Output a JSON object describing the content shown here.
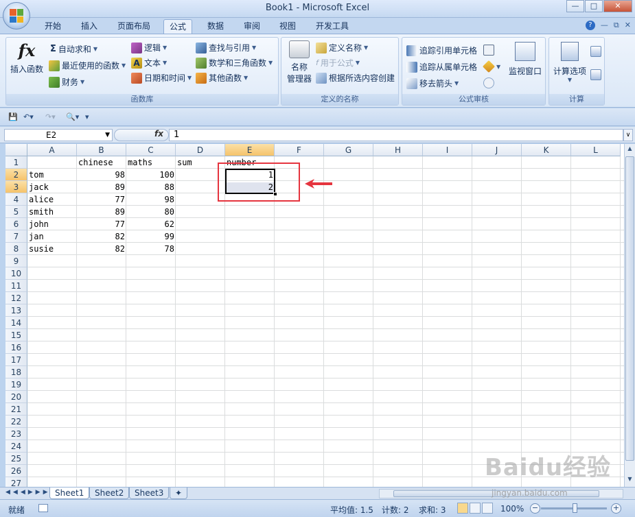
{
  "window": {
    "title": "Book1 - Microsoft Excel",
    "buttons": [
      "minimize",
      "maximize",
      "close"
    ]
  },
  "tabs": [
    {
      "label": "开始",
      "active": false
    },
    {
      "label": "插入",
      "active": false
    },
    {
      "label": "页面布局",
      "active": false
    },
    {
      "label": "公式",
      "active": true
    },
    {
      "label": "数据",
      "active": false
    },
    {
      "label": "审阅",
      "active": false
    },
    {
      "label": "视图",
      "active": false
    },
    {
      "label": "开发工具",
      "active": false
    }
  ],
  "ribbon": {
    "function_library": {
      "label": "函数库",
      "insert_function": "插入函数",
      "fx_symbol": "fx",
      "autosum": "自动求和",
      "recent": "最近使用的函数",
      "financial": "财务",
      "logical": "逻辑",
      "text": "文本",
      "datetime": "日期和时间",
      "lookup": "查找与引用",
      "math": "数学和三角函数",
      "more": "其他函数"
    },
    "defined_names": {
      "label": "定义的名称",
      "name_manager_line1": "名称",
      "name_manager_line2": "管理器",
      "define_name": "定义名称",
      "use_in_formula": "用于公式",
      "create_from_selection": "根据所选内容创建"
    },
    "formula_auditing": {
      "label": "公式审核",
      "trace_precedents": "追踪引用单元格",
      "trace_dependents": "追踪从属单元格",
      "remove_arrows": "移去箭头",
      "watch_window": "监视窗口"
    },
    "calculation": {
      "label": "计算",
      "calc_options": "计算选项"
    }
  },
  "formula_bar": {
    "name_box": "E2",
    "fx_label": "fx",
    "formula": "1"
  },
  "columns": [
    "A",
    "B",
    "C",
    "D",
    "E",
    "F",
    "G",
    "H",
    "I",
    "J",
    "K",
    "L"
  ],
  "rows": [
    "1",
    "2",
    "3",
    "4",
    "5",
    "6",
    "7",
    "8",
    "9",
    "10",
    "11",
    "12",
    "13",
    "14",
    "15",
    "16",
    "17",
    "18",
    "19",
    "20",
    "21",
    "22",
    "23",
    "24",
    "25",
    "26",
    "27"
  ],
  "selected_column": "E",
  "selected_rows": [
    "2",
    "3"
  ],
  "cells": {
    "headers": [
      "",
      "chinese",
      "maths",
      "sum",
      "number"
    ],
    "data": [
      {
        "name": "tom",
        "chinese": "98",
        "maths": "100",
        "number": "1"
      },
      {
        "name": "jack",
        "chinese": "89",
        "maths": "88",
        "number": "2"
      },
      {
        "name": "alice",
        "chinese": "77",
        "maths": "98"
      },
      {
        "name": "smith",
        "chinese": "89",
        "maths": "80"
      },
      {
        "name": "john",
        "chinese": "77",
        "maths": "62"
      },
      {
        "name": "jan",
        "chinese": "82",
        "maths": "99"
      },
      {
        "name": "susie",
        "chinese": "82",
        "maths": "78"
      }
    ]
  },
  "sheets": [
    {
      "label": "Sheet1",
      "active": true
    },
    {
      "label": "Sheet2",
      "active": false
    },
    {
      "label": "Sheet3",
      "active": false
    }
  ],
  "status": {
    "ready": "就绪",
    "average": "平均值: 1.5",
    "count": "计数: 2",
    "sum": "求和: 3",
    "zoom": "100%"
  },
  "watermark": {
    "text": "Baidu经验",
    "url": "jingyan.baidu.com"
  },
  "colors": {
    "annotation": "#e5343e",
    "selection_header": "#f5c36b",
    "accent": "#2d6bc4"
  }
}
